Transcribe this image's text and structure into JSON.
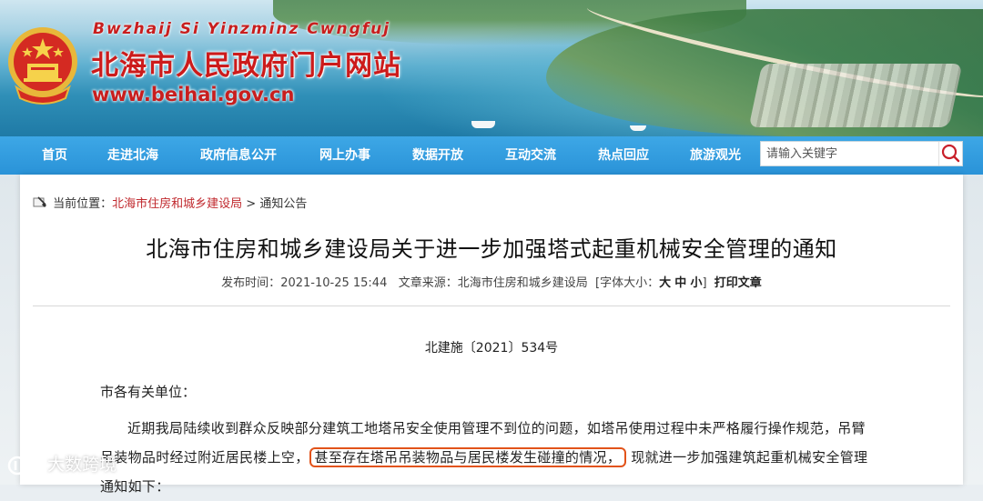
{
  "header": {
    "pinyin": "Bwzhaij Si Yinzminz Cwngfuj",
    "site_name": "北海市人民政府门户网站",
    "url": "www.beihai.gov.cn"
  },
  "nav": {
    "items": [
      {
        "label": "首页"
      },
      {
        "label": "走进北海"
      },
      {
        "label": "政府信息公开"
      },
      {
        "label": "网上办事"
      },
      {
        "label": "数据开放"
      },
      {
        "label": "互动交流"
      },
      {
        "label": "热点回应"
      },
      {
        "label": "旅游观光"
      }
    ],
    "search": {
      "placeholder": "请输入关键字"
    }
  },
  "breadcrumb": {
    "prefix": "当前位置：",
    "link": "北海市住房和城乡建设局",
    "separator": " > ",
    "current": "通知公告"
  },
  "article": {
    "title": "北海市住房和城乡建设局关于进一步加强塔式起重机械安全管理的通知",
    "meta": {
      "time_label": "发布时间：",
      "time": "2021-10-25 15:44",
      "source_label": "文章来源：",
      "source": "北海市住房和城乡建设局",
      "fontsize_label": "[字体大小：",
      "size_large": "大",
      "size_medium": "中",
      "size_small": "小",
      "fontsize_end": "]",
      "print": "打印文章"
    },
    "doc_number": "北建施〔2021〕534号",
    "salutation": "市各有关单位：",
    "paragraph_before": "近期我局陆续收到群众反映部分建筑工地塔吊安全使用管理不到位的问题，如塔吊使用过程中未严格履行操作规范，吊臂吊装物品时经过附近居民楼上空，",
    "paragraph_highlight": "甚至存在塔吊吊装物品与居民楼发生碰撞的情况，",
    "paragraph_after": "现就进一步加强建筑起重机械安全管理通知如下："
  },
  "watermark": {
    "text": "大数跨境"
  },
  "colors": {
    "nav_bg": "#2a93d8",
    "title_red": "#cc1b1b",
    "breadcrumb_link": "#c0282d",
    "highlight_border": "#e2531a"
  }
}
